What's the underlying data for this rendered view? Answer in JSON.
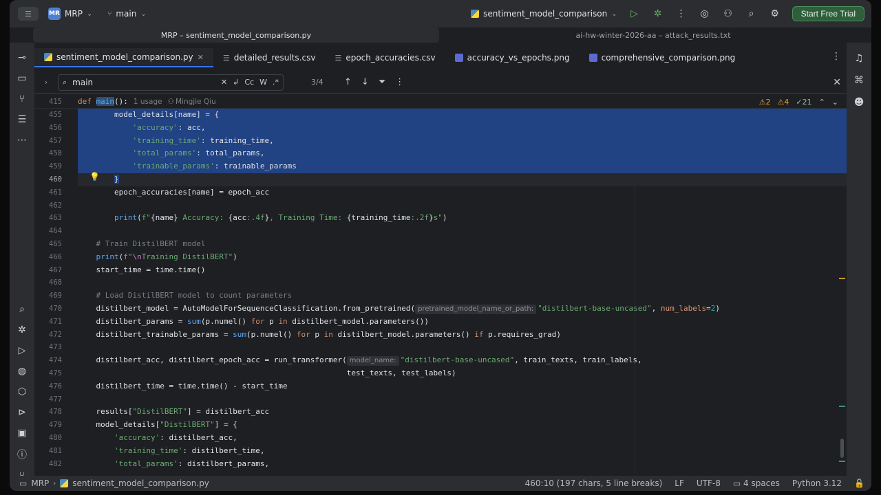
{
  "titlebar": {
    "project_badge": "MR",
    "project": "MRP",
    "branch": "main",
    "run_config": "sentiment_model_comparison",
    "trial_button": "Start Free Trial"
  },
  "windows": {
    "active": "MRP – sentiment_model_comparison.py",
    "other": "ai-hw-winter-2026-aa – attack_results.txt"
  },
  "tabs": [
    {
      "label": "sentiment_model_comparison.py",
      "type": "py",
      "active": true
    },
    {
      "label": "detailed_results.csv",
      "type": "csv"
    },
    {
      "label": "epoch_accuracies.csv",
      "type": "csv"
    },
    {
      "label": "accuracy_vs_epochs.png",
      "type": "png"
    },
    {
      "label": "comprehensive_comparison.png",
      "type": "png"
    }
  ],
  "find": {
    "query": "main",
    "count": "3/4",
    "opt_case": "Cc",
    "opt_word": "W",
    "opt_regex": ".*"
  },
  "sticky": {
    "line": "415",
    "def_kw": "def",
    "fn_name": "main",
    "rest": "():",
    "usage": "1 usage",
    "author": "Mingjie Qiu"
  },
  "inspections": {
    "errors": "2",
    "warnings": "4",
    "weak": "21"
  },
  "code_lines": [
    {
      "n": "455",
      "html": "        model_details[name] = {",
      "sel": true
    },
    {
      "n": "456",
      "html": "            <span class='str'>'accuracy'</span>: acc,",
      "sel": true
    },
    {
      "n": "457",
      "html": "            <span class='str'>'training_time'</span>: training_time,",
      "sel": true
    },
    {
      "n": "458",
      "html": "            <span class='str'>'total_params'</span>: total_params,",
      "sel": true
    },
    {
      "n": "459",
      "html": "            <span class='str'>'trainable_params'</span>: trainable_params",
      "sel": true
    },
    {
      "n": "460",
      "html": "        <span class='sel'>}</span>",
      "cur": true
    },
    {
      "n": "461",
      "html": "        epoch_accuracies[name] = epoch_acc"
    },
    {
      "n": "462",
      "html": ""
    },
    {
      "n": "463",
      "html": "        <span class='fn'>print</span>(<span class='str'>f\"</span>{name}<span class='str'> Accuracy: </span>{acc<span class='str'>:.4f</span>}<span class='str'>, Training Time: </span>{training_time<span class='str'>:.2f</span>}<span class='str'>s\"</span>)"
    },
    {
      "n": "464",
      "html": ""
    },
    {
      "n": "465",
      "html": "    <span class='cm'># Train DistilBERT model</span>"
    },
    {
      "n": "466",
      "html": "    <span class='fn'>print</span>(<span class='str'>f\"</span><span class='fmt'>\\n</span><span class='str'>Training DistilBERT\"</span>)"
    },
    {
      "n": "467",
      "html": "    start_time = time.time()"
    },
    {
      "n": "468",
      "html": ""
    },
    {
      "n": "469",
      "html": "    <span class='cm'># Load DistilBERT model to count parameters</span>"
    },
    {
      "n": "470",
      "html": "    distilbert_model = AutoModelForSequenceClassification.from_pretrained(<span class='hint'>pretrained_model_name_or_path:</span><span class='str'>\"distilbert-base-uncased\"</span>, <span class='param'>num_labels</span>=<span class='num'>2</span>)"
    },
    {
      "n": "471",
      "html": "    distilbert_params = <span class='fn'>sum</span>(p.numel() <span class='kw'>for</span> p <span class='kw'>in</span> distilbert_model.parameters())"
    },
    {
      "n": "472",
      "html": "    distilbert_trainable_params = <span class='fn'>sum</span>(p.numel() <span class='kw'>for</span> p <span class='kw'>in</span> distilbert_model.parameters() <span class='kw'>if</span> p.requires_grad)"
    },
    {
      "n": "473",
      "html": ""
    },
    {
      "n": "474",
      "html": "    distilbert_acc, distilbert_epoch_acc = run_transformer(<span class='hint'>model_name:</span><span class='str'>\"distilbert-base-uncased\"</span>, train_texts, train_labels,"
    },
    {
      "n": "475",
      "html": "                                                           test_texts, test_labels)"
    },
    {
      "n": "476",
      "html": "    distilbert_time = time.time() - start_time"
    },
    {
      "n": "477",
      "html": ""
    },
    {
      "n": "478",
      "html": "    results[<span class='str'>\"DistilBERT\"</span>] = distilbert_acc"
    },
    {
      "n": "479",
      "html": "    model_details[<span class='str'>\"DistilBERT\"</span>] = {"
    },
    {
      "n": "480",
      "html": "        <span class='str'>'accuracy'</span>: distilbert_acc,"
    },
    {
      "n": "481",
      "html": "        <span class='str'>'training_time'</span>: distilbert_time,"
    },
    {
      "n": "482",
      "html": "        <span class='str'>'total_params'</span>: distilbert_params,"
    }
  ],
  "status": {
    "project": "MRP",
    "file": "sentiment_model_comparison.py",
    "position": "460:10 (197 chars, 5 line breaks)",
    "line_sep": "LF",
    "encoding": "UTF-8",
    "indent": "4 spaces",
    "interpreter": "Python 3.12"
  },
  "colors": {
    "accent": "#3574f0",
    "selection": "#214283",
    "trial_bg": "#2f5e3a"
  }
}
